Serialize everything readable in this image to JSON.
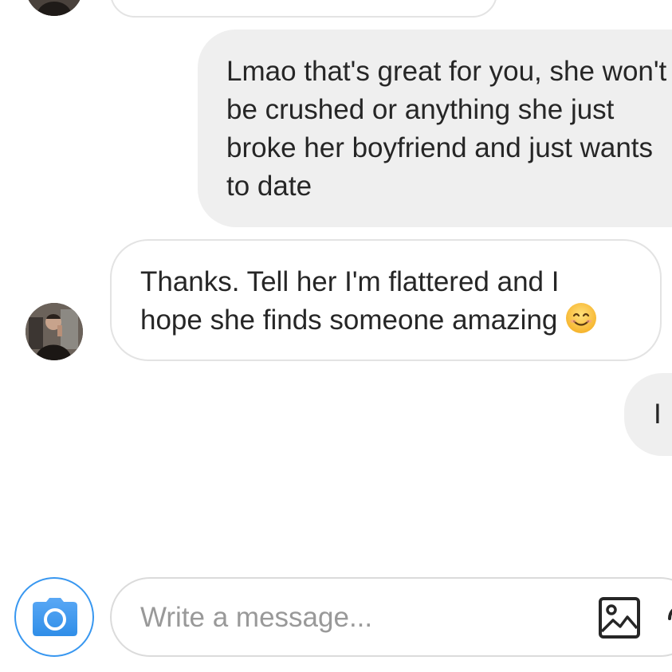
{
  "thread": {
    "messages": [
      {
        "id": "m1",
        "direction": "outgoing",
        "text_lines": [
          "Lmao that's great for you, she won't",
          "be crushed or anything she just",
          "broke her boyfriend and just wants",
          "to date"
        ]
      },
      {
        "id": "m2",
        "direction": "incoming",
        "text_lines": [
          "Thanks. Tell her I'm flattered and I",
          "hope she finds someone amazing"
        ],
        "emoji": "smiling-face-emoji"
      },
      {
        "id": "m3",
        "direction": "outgoing",
        "text": "I"
      }
    ]
  },
  "composer": {
    "placeholder": "Write a message...",
    "value": "",
    "camera_icon": "camera-icon",
    "gallery_icon": "image-icon"
  },
  "colors": {
    "outgoing_bubble": "#efefef",
    "incoming_border": "#e3e3e3",
    "accent_blue": "#3897f0",
    "text": "#262626",
    "placeholder": "#999999"
  }
}
